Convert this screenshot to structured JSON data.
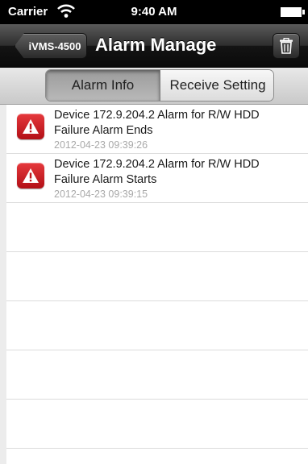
{
  "status_bar": {
    "carrier": "Carrier",
    "time": "9:40 AM"
  },
  "nav": {
    "back_label": "iVMS-4500",
    "title": "Alarm Manage",
    "trash_icon": "trash-icon"
  },
  "segments": [
    {
      "label": "Alarm Info",
      "selected": true
    },
    {
      "label": "Receive Setting",
      "selected": false
    }
  ],
  "alarms": [
    {
      "line1": "Device 172.9.204.2 Alarm for R/W HDD",
      "line2": "Failure Alarm Ends",
      "time": "2012-04-23 09:39:26",
      "icon": "warning-icon"
    },
    {
      "line1": "Device 172.9.204.2 Alarm for R/W HDD",
      "line2": "Failure Alarm Starts",
      "time": "2012-04-23 09:39:15",
      "icon": "warning-icon"
    }
  ],
  "colors": {
    "nav_bar": "#1e1e1e",
    "alarm_icon": "#d0222a",
    "timestamp": "#a9a9a9"
  }
}
